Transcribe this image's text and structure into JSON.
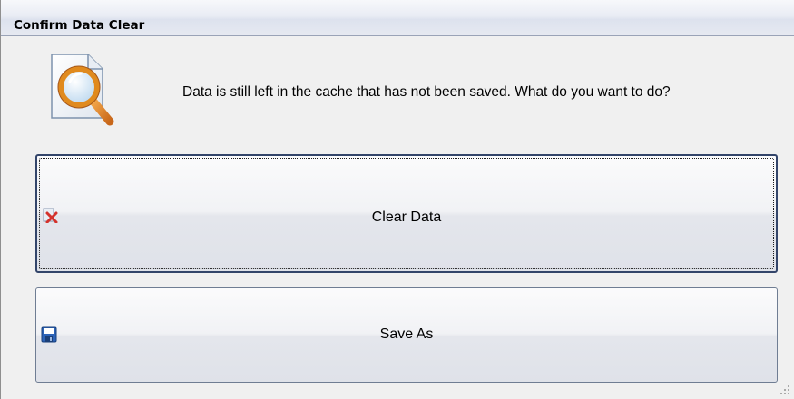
{
  "window": {
    "title": "Confirm Data Clear"
  },
  "message": {
    "text": "Data is still left in the cache that has not been saved.  What do you want to do?",
    "icon": "document-magnifier-icon"
  },
  "buttons": {
    "clear": {
      "label": "Clear Data",
      "icon": "clear-data-icon"
    },
    "save": {
      "label": "Save As",
      "icon": "floppy-disk-icon"
    }
  },
  "colors": {
    "accent_orange": "#e08a1e",
    "save_icon_blue": "#2c63b8",
    "clear_icon_red": "#d4322c"
  }
}
